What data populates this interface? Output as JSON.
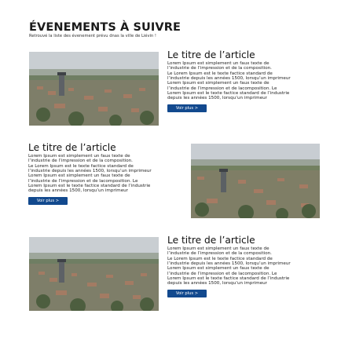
{
  "header": {
    "title": "ÉVENEMENTS À SUIVRE",
    "subtitle": "Retrouvé la liste des évenement prévu dnas la ville de Liévin !"
  },
  "articles": [
    {
      "title": "Le titre de l’article",
      "body": "Lorem Ipsum est simplement un faux texte de\nl’industrie de l’impression et de la composition.\nLe Lorem Ipsum est le texte factice standard de\nl’industrie depuis les années 1500, lorsqu’un imprimeur\nLorem Ipsum est simplement un faux texte de\nl’industrie de l’impression et de lacomposition. Le\nLorem Ipsum est le texte factice standard de l’industrie\ndepuis les années 1500, lorsqu’un imprimeur",
      "button": "Voir plus >"
    },
    {
      "title": "Le titre de l’article",
      "body": "Lorem Ipsum est simplement un faux texte de\nl’industrie de l’impression et de la composition.\nLe Lorem Ipsum est le texte factice standard de\nl’industrie depuis les années 1500, lorsqu’un imprimeur\nLorem Ipsum est simplement un faux texte de\nl’industrie de l’impression et de lacomposition. Le\nLorem Ipsum est le texte factice standard de l’industrie\ndepuis les années 1500, lorsqu’un imprimeur",
      "button": "Voir plus >"
    },
    {
      "title": "Le titre de l’article",
      "body": "Lorem Ipsum est simplement un faux texte de\nl’industrie de l’impression et de la composition.\nLe Lorem Ipsum est le texte factice standard de\nl’industrie depuis les années 1500, lorsqu’un imprimeur\nLorem Ipsum est simplement un faux texte de\nl’industrie de l’impression et de lacomposition. Le\nLorem Ipsum est le texte factice standard de l’industrie\ndepuis les années 1500, lorsqu’un imprimeur",
      "button": "Voir plus >"
    }
  ],
  "colors": {
    "button_bg": "#12498e",
    "button_text": "#ffffff",
    "heading": "#1a1a1a"
  }
}
